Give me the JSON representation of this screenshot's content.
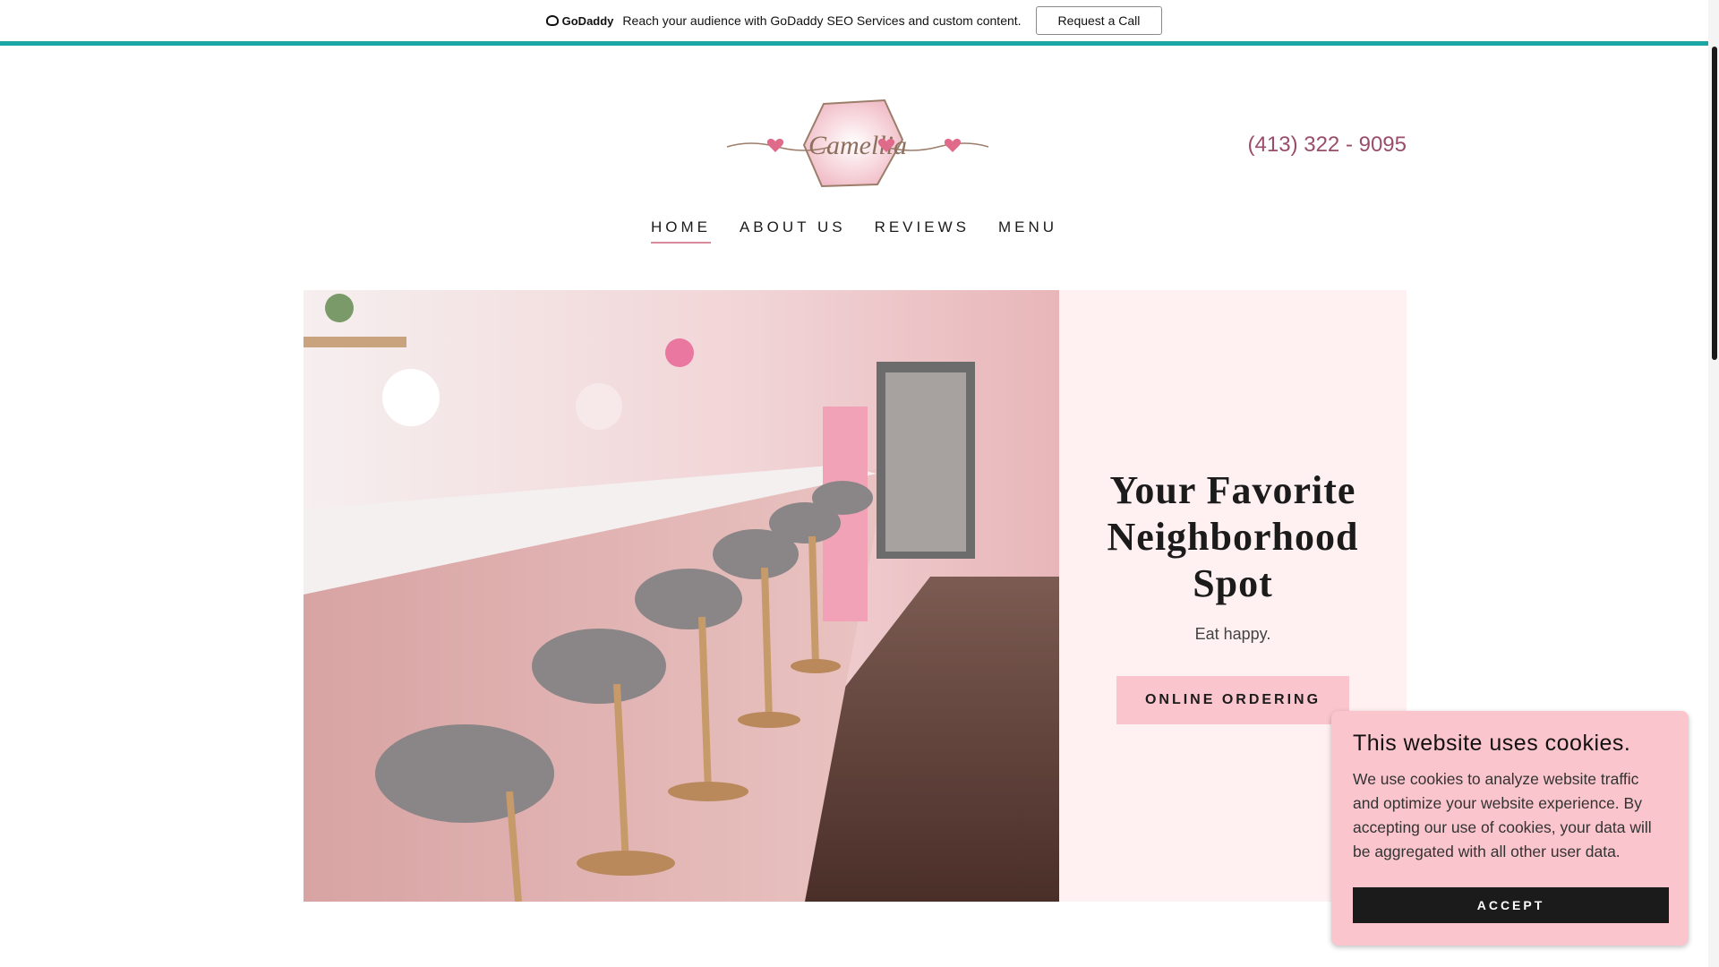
{
  "promo": {
    "brand": "GoDaddy",
    "message": "Reach your audience with GoDaddy SEO Services and custom content.",
    "cta_label": "Request a Call"
  },
  "header": {
    "logo_text": "Camellia",
    "phone": "(413) 322 - 9095"
  },
  "nav": {
    "items": [
      {
        "label": "HOME"
      },
      {
        "label": "ABOUT US"
      },
      {
        "label": "REVIEWS"
      },
      {
        "label": "MENU"
      }
    ]
  },
  "hero": {
    "title": "Your Favorite Neighborhood Spot",
    "subtitle": "Eat happy.",
    "button_label": "ONLINE ORDERING"
  },
  "cookie": {
    "title": "This website uses cookies.",
    "body": "We use cookies to analyze website traffic and optimize your website experience. By accepting our use of cookies, your data will be aggregated with all other user data.",
    "accept_label": "ACCEPT"
  },
  "colors": {
    "accent_teal": "#1ba5a5",
    "phone": "#9a4d6a",
    "hero_panel": "#fff0f1",
    "pink_button": "#fbc5cd",
    "dark_button": "#1b1b1b"
  }
}
